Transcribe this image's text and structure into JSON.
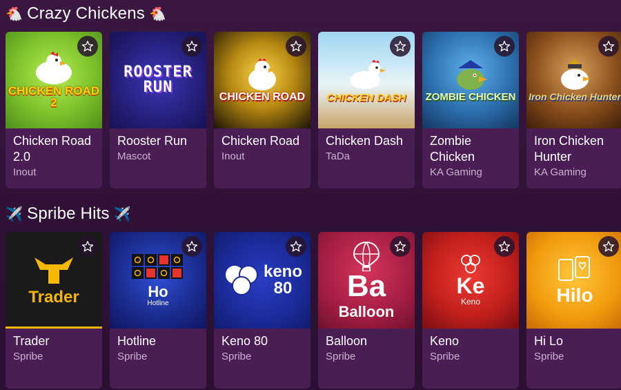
{
  "sections": [
    {
      "title": "Crazy Chickens",
      "emoji": "🐔",
      "games": [
        {
          "name": "Chicken Road 2.0",
          "provider": "Inout",
          "art_title": "CHICKEN ROAD 2",
          "accent": "#8fd13a"
        },
        {
          "name": "Rooster Run",
          "provider": "Mascot",
          "art_title": "ROOSTER RUN",
          "accent": "#2d2a8f"
        },
        {
          "name": "Chicken Road",
          "provider": "Inout",
          "art_title": "CHICKEN ROAD",
          "accent": "#f0c419"
        },
        {
          "name": "Chicken Dash",
          "provider": "TaDa",
          "art_title": "CHICKEN DASH",
          "accent": "#8fc8e8"
        },
        {
          "name": "Zombie Chicken",
          "provider": "KA Gaming",
          "art_title": "ZOMBIE CHICKEN",
          "accent": "#3a8fd0"
        },
        {
          "name": "Iron Chicken Hunter",
          "provider": "KA Gaming",
          "art_title": "Iron Chicken Hunter",
          "accent": "#b8752e"
        }
      ]
    },
    {
      "title": "Spribe Hits",
      "emoji": "✈️",
      "games": [
        {
          "name": "Trader",
          "provider": "Spribe",
          "art_title": "Trader",
          "accent": "#f5b800"
        },
        {
          "name": "Hotline",
          "provider": "Spribe",
          "art_title": "Ho",
          "art_sub": "Hotline",
          "accent": "#2236a8"
        },
        {
          "name": "Keno 80",
          "provider": "Spribe",
          "art_title": "keno",
          "art_sub": "80",
          "accent": "#1d2d9a"
        },
        {
          "name": "Balloon",
          "provider": "Spribe",
          "art_title": "Ba",
          "art_sub": "Balloon",
          "accent": "#b02244"
        },
        {
          "name": "Keno",
          "provider": "Spribe",
          "art_title": "Ke",
          "art_sub": "Keno",
          "accent": "#c81c1c"
        },
        {
          "name": "Hi Lo",
          "provider": "Spribe",
          "art_title": "Hilo",
          "accent": "#f2a20f"
        }
      ]
    }
  ]
}
